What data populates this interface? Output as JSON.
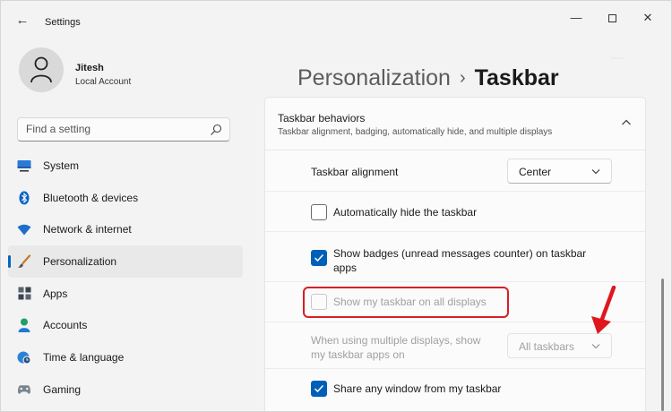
{
  "window": {
    "title": "Settings",
    "minimize_icon": "minimize-icon",
    "maximize_icon": "maximize-icon",
    "close_icon": "close-icon",
    "minimize_glyph": "—",
    "close_glyph": "✕",
    "back_glyph": "←"
  },
  "profile": {
    "name": "Jitesh",
    "account_type": "Local Account"
  },
  "search": {
    "placeholder": "Find a setting"
  },
  "sidebar": {
    "items": [
      {
        "label": "System",
        "icon": "monitor-icon"
      },
      {
        "label": "Bluetooth & devices",
        "icon": "bluetooth-icon"
      },
      {
        "label": "Network & internet",
        "icon": "wifi-icon"
      },
      {
        "label": "Personalization",
        "icon": "brush-icon",
        "active": true
      },
      {
        "label": "Apps",
        "icon": "apps-icon"
      },
      {
        "label": "Accounts",
        "icon": "person-icon"
      },
      {
        "label": "Time & language",
        "icon": "globe-clock-icon"
      },
      {
        "label": "Gaming",
        "icon": "gamepad-icon"
      }
    ]
  },
  "header": {
    "breadcrumb_parent": "Personalization",
    "separator": "›",
    "current": "Taskbar"
  },
  "panel": {
    "title": "Taskbar behaviors",
    "subtitle": "Taskbar alignment, badging, automatically hide, and multiple displays",
    "alignment": {
      "label": "Taskbar alignment",
      "value": "Center"
    },
    "auto_hide": {
      "label": "Automatically hide the taskbar",
      "checked": false
    },
    "badges": {
      "label_line1": "Show badges (unread messages counter) on taskbar",
      "label_line2": "apps",
      "checked": true
    },
    "all_displays": {
      "label": "Show my taskbar on all displays",
      "checked": false,
      "disabled": true
    },
    "multi_display_apps": {
      "label_line1": "When using multiple displays, show",
      "label_line2": "my taskbar apps on",
      "value": "All taskbars",
      "disabled": true
    },
    "share_window": {
      "label": "Share any window from my taskbar",
      "checked": true
    }
  },
  "colors": {
    "accent": "#005fb8",
    "highlight": "#d61f26",
    "annotation_arrow": "#e0161c"
  }
}
